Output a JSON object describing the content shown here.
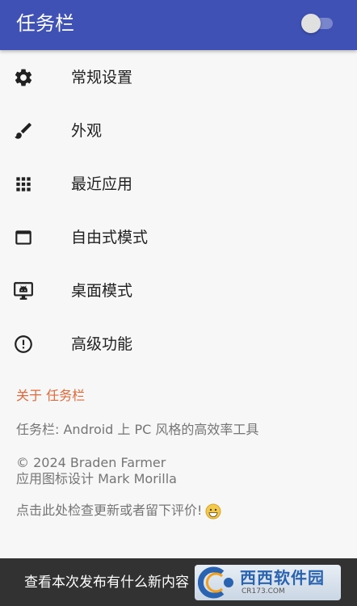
{
  "app_bar": {
    "title": "任务栏",
    "enabled": false
  },
  "menu": [
    {
      "label": "常规设置",
      "icon": "gear-icon"
    },
    {
      "label": "外观",
      "icon": "brush-icon"
    },
    {
      "label": "最近应用",
      "icon": "apps-grid-icon"
    },
    {
      "label": "自由式模式",
      "icon": "window-icon"
    },
    {
      "label": "桌面模式",
      "icon": "desktop-android-icon"
    },
    {
      "label": "高级功能",
      "icon": "exclamation-circle-icon"
    }
  ],
  "about": {
    "header": "关于 任务栏",
    "description": "任务栏: Android 上 PC 风格的高效率工具",
    "copyright": "© 2024 Braden Farmer",
    "icon_credit": "应用图标设计 Mark Morilla",
    "update_prompt": "点击此处检查更新或者留下评价!"
  },
  "snackbar": {
    "text": "查看本次发布有什么新内容"
  },
  "watermark": {
    "brand": "西西软件园",
    "url": "CR173.COM"
  },
  "colors": {
    "app_bar": "#3f51b5",
    "accent": "#e06a3a",
    "snackbar": "#323232"
  }
}
